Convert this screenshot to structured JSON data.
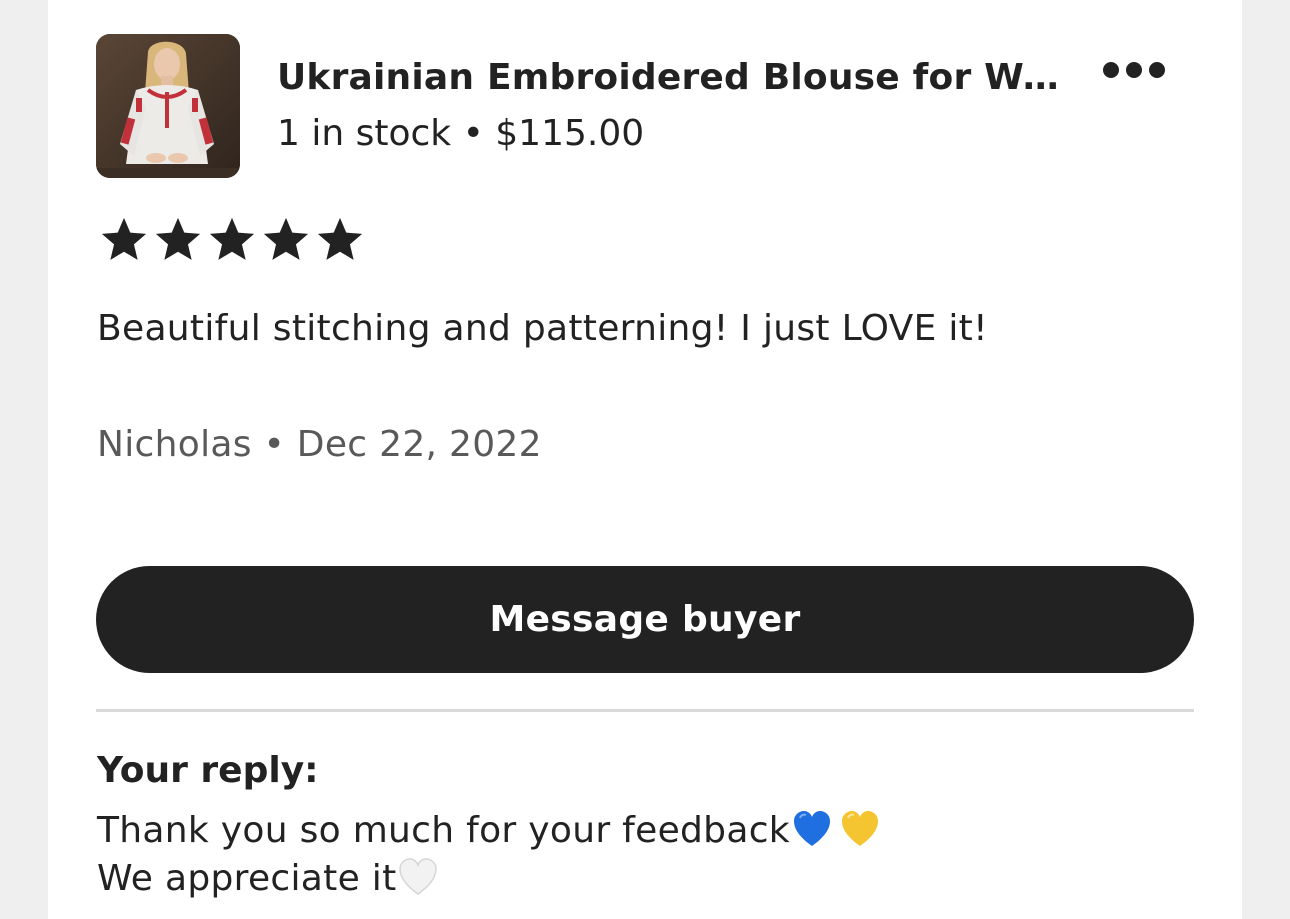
{
  "listing": {
    "title": "Ukrainian Embroidered Blouse for Wo...",
    "meta": "1 in stock • $115.00",
    "image_icon": "product-photo-embroidered-blouse"
  },
  "more_menu": {
    "icon": "more-horizontal-icon"
  },
  "review": {
    "rating": 5,
    "rating_max": 5,
    "text": "Beautiful stitching and patterning! I just LOVE it!",
    "byline": "Nicholas • Dec 22, 2022"
  },
  "actions": {
    "message_buyer_label": "Message buyer"
  },
  "reply": {
    "label": "Your reply:",
    "line1": "Thank you so much for your feedback",
    "line2": "We appreciate it",
    "line1_emoji": [
      "blue-heart-icon",
      "yellow-heart-icon"
    ],
    "line2_emoji": [
      "white-heart-icon"
    ]
  },
  "colors": {
    "text": "#222222",
    "muted": "#595959",
    "button_bg": "#222222",
    "button_text": "#ffffff",
    "page_bg": "#efefef",
    "card_bg": "#ffffff",
    "blue_heart": "#1f6fe0",
    "yellow_heart": "#f5c531",
    "white_heart": "#f2f2f2"
  }
}
